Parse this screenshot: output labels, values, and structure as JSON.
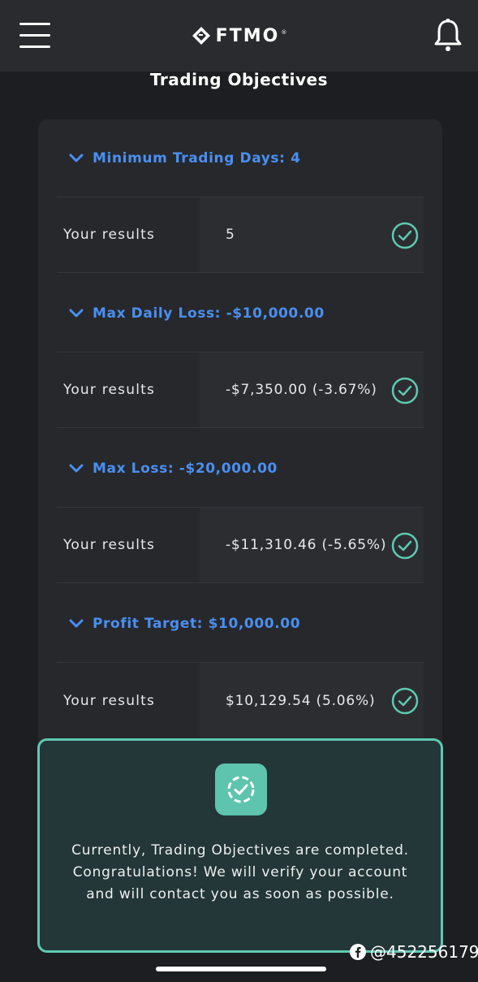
{
  "header": {
    "logo_text": "FTMO",
    "logo_reg": "®"
  },
  "page": {
    "title": "Trading Objectives"
  },
  "objectives": [
    {
      "header": "Minimum Trading Days: 4",
      "result_label": "Your results",
      "result_value": "5"
    },
    {
      "header": "Max Daily Loss: -$10,000.00",
      "result_label": "Your results",
      "result_value": "-$7,350.00 (-3.67%)"
    },
    {
      "header": "Max Loss: -$20,000.00",
      "result_label": "Your results",
      "result_value": "-$11,310.46 (-5.65%)"
    },
    {
      "header": "Profit Target: $10,000.00",
      "result_label": "Your results",
      "result_value": "$10,129.54 (5.06%)"
    }
  ],
  "banner": {
    "message": "Currently, Trading Objectives are completed. Congratulations! We will verify your account and will contact you as soon as possible."
  },
  "watermark": {
    "text": "@452256179"
  },
  "colors": {
    "accent_blue": "#4a8ff0",
    "success_teal": "#5fc9b1",
    "background": "#1d1e21",
    "card": "#27282c"
  }
}
